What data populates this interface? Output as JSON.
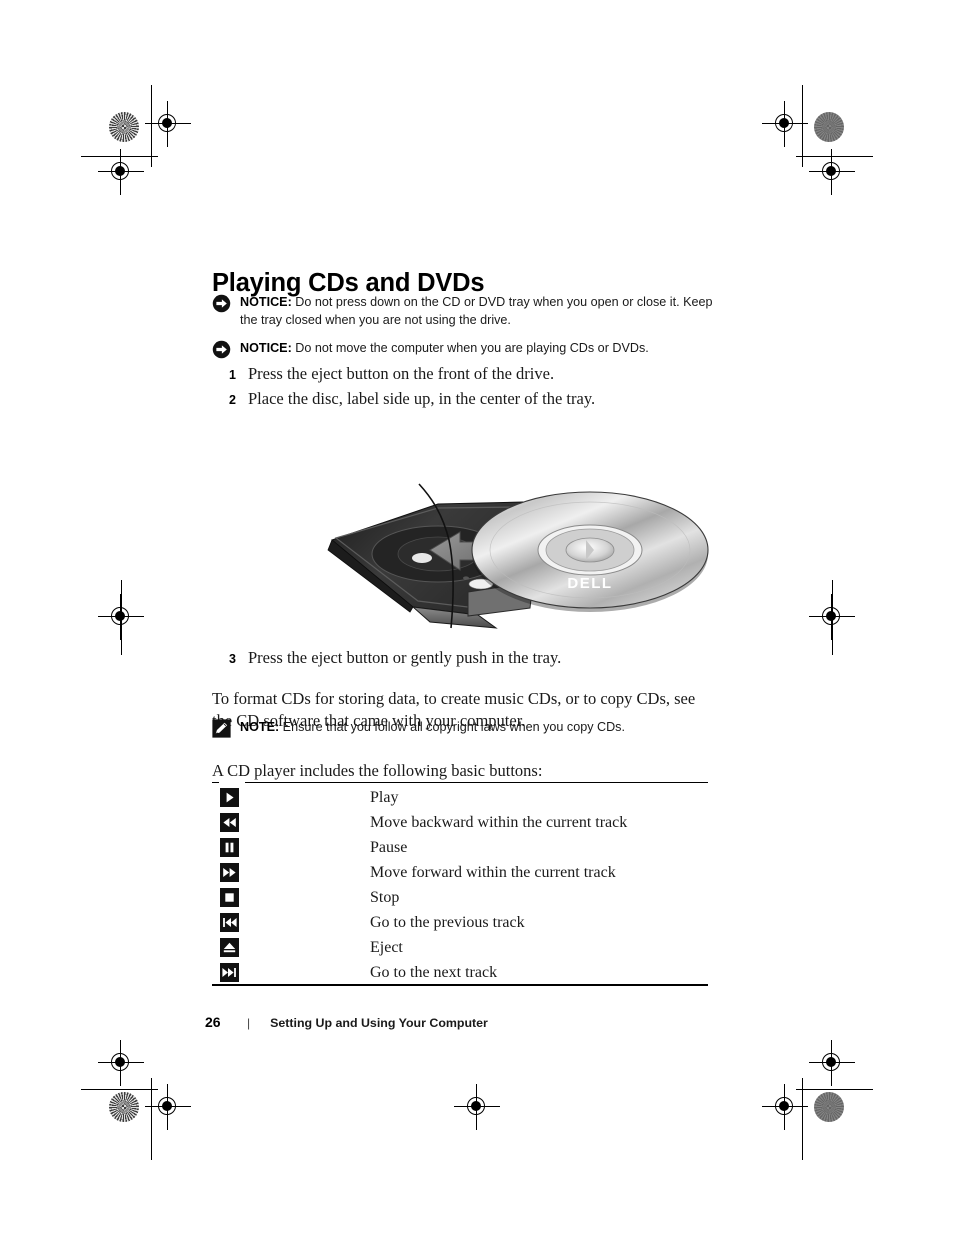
{
  "document": {
    "heading": "Playing CDs and DVDs",
    "notices": [
      {
        "icon": "notice-arrow-icon",
        "label": "NOTICE:",
        "text": " Do not press down on the CD or DVD tray when you open or close it. Keep the tray closed when you are not using the drive."
      },
      {
        "icon": "notice-arrow-icon",
        "label": "NOTICE:",
        "text": " Do not move the computer when you are playing CDs or DVDs."
      }
    ],
    "steps_before_figure": [
      {
        "number": "1",
        "text": "Press the eject button on the front of the drive."
      },
      {
        "number": "2",
        "text": "Place the disc, label side up, in the center of the tray."
      }
    ],
    "figure": {
      "caption": "",
      "alt": "Open optical drive tray with a DELL-branded CD being placed on it",
      "disc_label": "DELL"
    },
    "steps_after_figure": [
      {
        "number": "3",
        "text": "Press the eject button or gently push in the tray."
      }
    ],
    "paragraph_format": "To format CDs for storing data, to create music CDs, or to copy CDs, see the CD software that came with your computer.",
    "note": {
      "icon": "note-pencil-icon",
      "label": "NOTE:",
      "text": " Ensure that you follow all copyright laws when you copy CDs."
    },
    "paragraph_buttons_intro": "A CD player includes the following basic buttons:",
    "buttons_table": {
      "rows": [
        {
          "icon": "play-icon",
          "description": "Play"
        },
        {
          "icon": "rewind-icon",
          "description": "Move backward within the current track"
        },
        {
          "icon": "pause-icon",
          "description": "Pause"
        },
        {
          "icon": "fast-forward-icon",
          "description": "Move forward within the current track"
        },
        {
          "icon": "stop-icon",
          "description": "Stop"
        },
        {
          "icon": "previous-track-icon",
          "description": "Go to the previous track"
        },
        {
          "icon": "eject-icon",
          "description": "Eject"
        },
        {
          "icon": "next-track-icon",
          "description": "Go to the next track"
        }
      ]
    },
    "footer": {
      "page_number": "26",
      "separator": "|",
      "section_title": "Setting Up and Using Your Computer"
    }
  },
  "colors": {
    "text": "#1a1a1a",
    "heading": "#000000",
    "rule": "#000000",
    "icon_fill": "#111111"
  }
}
